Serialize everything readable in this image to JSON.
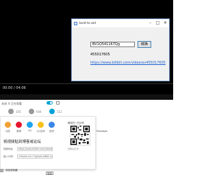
{
  "window": {
    "title": "bvid to aid",
    "bv_value": "BV1Q541167Qg",
    "convert_label": "转换",
    "av_number": "455017605",
    "av_link": "https://www.bilibili.com/video/av455017605",
    "controls": {
      "minimize": "–",
      "maximize": "□",
      "close": "✕"
    }
  },
  "player": {
    "time": "00:00 / 04:06"
  },
  "sendbar": {
    "left": "关闭",
    "label": "0 正在观看"
  },
  "actions": [
    {
      "label": "335"
    },
    {
      "label": "644"
    },
    {
      "label": "112"
    }
  ],
  "share": {
    "items": [
      "动态",
      "微博",
      "QQ",
      "QQ空间",
      "贴吧"
    ],
    "embed_title": "将视频贴到博客或论坛",
    "video_address_label": "视频地址",
    "video_address_value": "https://www.bilibili.com/video/BV1Q541167Qg",
    "embed_code_label": "嵌入代码",
    "embed_code_value": "<iframe src=\"//player.bilibili.com/player.html?aid=455017605\"",
    "copy_label": "复制",
    "qr_caption": "微信扫一扫分享",
    "qr_hint": "扫码后分享"
  },
  "side_text": "Paradigm",
  "bottom_left": "添加到收藏"
}
